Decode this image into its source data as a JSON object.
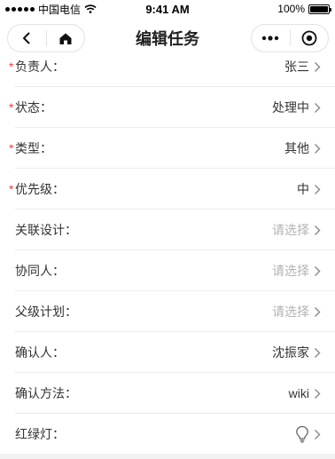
{
  "status_bar": {
    "carrier": "中国电信",
    "time": "9:41 AM",
    "battery": "100%"
  },
  "nav": {
    "title": "编辑任务",
    "icons": [
      "back-icon",
      "home-icon",
      "more-icon",
      "close-circle-icon"
    ]
  },
  "form": {
    "rows": [
      {
        "label": "负责人：",
        "value": "张三",
        "required": true
      },
      {
        "label": "状态：",
        "value": "处理中",
        "required": true
      },
      {
        "label": "类型：",
        "value": "其他",
        "required": true
      },
      {
        "label": "优先级：",
        "value": "中",
        "required": true
      },
      {
        "label": "关联设计：",
        "placeholder": "请选择",
        "required": false
      },
      {
        "label": "协同人：",
        "placeholder": "请选择",
        "required": false
      },
      {
        "label": "父级计划：",
        "placeholder": "请选择",
        "required": false
      },
      {
        "label": "确认人：",
        "value": "沈振家",
        "required": false
      },
      {
        "label": "确认方法：",
        "value": "wiki",
        "required": false
      },
      {
        "label": "红绿灯：",
        "value_icon": "lightbulb-icon",
        "required": false
      }
    ],
    "required_mark": "*"
  },
  "colors": {
    "required": "#e64340",
    "placeholder": "#b2b2b2",
    "text": "#333333"
  }
}
